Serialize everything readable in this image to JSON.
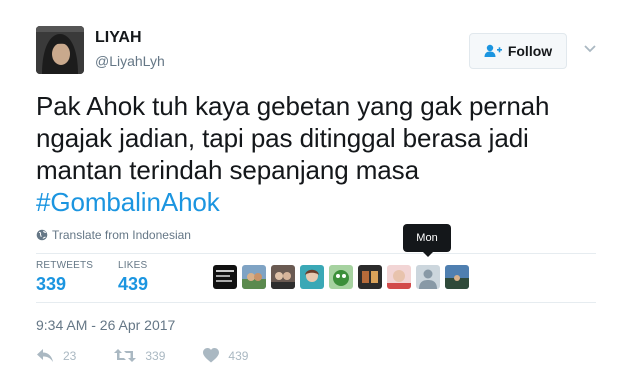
{
  "author": {
    "name": "LIYAH",
    "handle": "@LiyahLyh"
  },
  "follow_button": {
    "label": "Follow"
  },
  "tweet": {
    "text_line1": "Pak Ahok tuh kaya gebetan yang gak pernah",
    "text_line2": "ngajak jadian, tapi pas ditinggal berasa jadi",
    "text_line3": "mantan terindah sepanjang masa",
    "hashtag": "#GombalinAhok",
    "translate_label": "Translate from Indonesian"
  },
  "stats": {
    "retweets_label": "RETWEETS",
    "retweets_value": "339",
    "likes_label": "LIKES",
    "likes_value": "439"
  },
  "liker_tooltip": "Mon",
  "timestamp": "9:34 AM - 26 Apr 2017",
  "actions": {
    "reply_count": "23",
    "retweet_count": "339",
    "like_count": "439"
  },
  "colors": {
    "link_blue": "#1b95e0",
    "secondary_text": "#657786",
    "action_gray": "#aab8c2"
  },
  "icons": {
    "follow": "add-user-icon",
    "caret": "chevron-down-icon",
    "translate": "globe-icon",
    "reply": "reply-icon",
    "retweet": "retweet-icon",
    "like": "heart-icon"
  }
}
